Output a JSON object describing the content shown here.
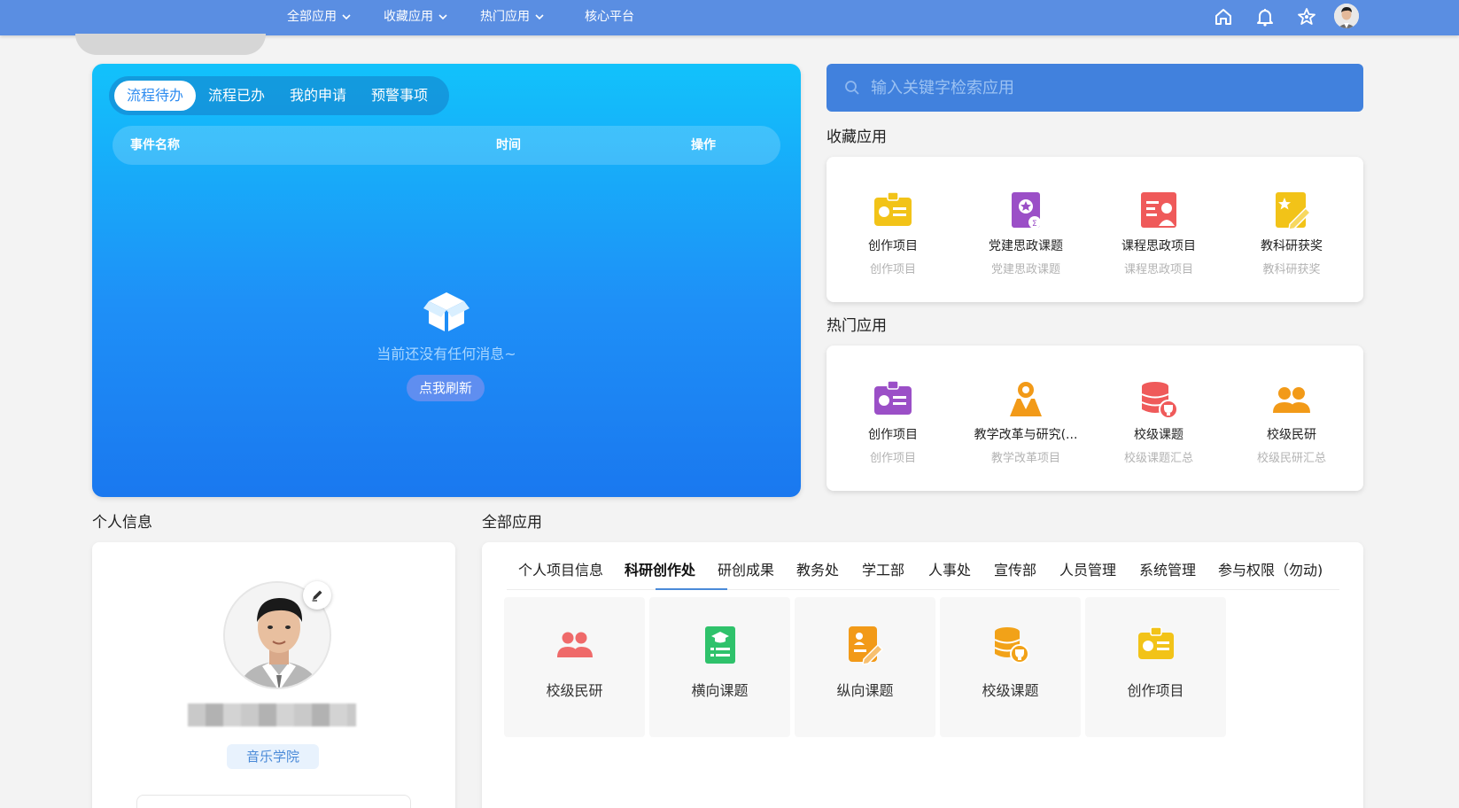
{
  "nav": {
    "items": [
      {
        "label": "全部应用",
        "dropdown": true
      },
      {
        "label": "收藏应用",
        "dropdown": true
      },
      {
        "label": "热门应用",
        "dropdown": true
      },
      {
        "label": "核心平台",
        "dropdown": false
      }
    ],
    "icons": [
      "home-icon",
      "bell-icon",
      "settings-star-icon"
    ]
  },
  "todo": {
    "tabs": [
      "流程待办",
      "流程已办",
      "我的申请",
      "预警事项"
    ],
    "active_tab": "流程待办",
    "columns": {
      "name": "事件名称",
      "time": "时间",
      "action": "操作"
    },
    "empty_text": "当前还没有任何消息~",
    "refresh_label": "点我刷新"
  },
  "search": {
    "placeholder": "输入关键字检索应用"
  },
  "favorites": {
    "title": "收藏应用",
    "apps": [
      {
        "name": "创作项目",
        "sub": "创作项目",
        "icon": "creative-project-icon",
        "color": "#f2c318"
      },
      {
        "name": "党建思政课题",
        "sub": "党建思政课题",
        "icon": "party-topic-icon",
        "color": "#9b4fc7"
      },
      {
        "name": "课程思政项目",
        "sub": "课程思政项目",
        "icon": "course-project-icon",
        "color": "#ef5a5a"
      },
      {
        "name": "教科研获奖",
        "sub": "教科研获奖",
        "icon": "award-icon",
        "color": "#f2c318"
      }
    ]
  },
  "hot": {
    "title": "热门应用",
    "apps": [
      {
        "name": "创作项目",
        "sub": "创作项目",
        "icon": "creative-project-icon",
        "color": "#9b4fc7"
      },
      {
        "name": "教学改革与研究(...",
        "sub": "教学改革项目",
        "icon": "teaching-reform-icon",
        "color": "#f29a18"
      },
      {
        "name": "校级课题",
        "sub": "校级课题汇总",
        "icon": "school-topic-icon",
        "color": "#ef5a5a"
      },
      {
        "name": "校级民研",
        "sub": "校级民研汇总",
        "icon": "people-research-icon",
        "color": "#f29a18"
      }
    ]
  },
  "profile": {
    "title": "个人信息",
    "department": "音乐学院"
  },
  "all_apps": {
    "title": "全部应用",
    "tabs": [
      "个人项目信息",
      "科研创作处",
      "研创成果",
      "教务处",
      "学工部",
      "人事处",
      "宣传部",
      "人员管理",
      "系统管理",
      "参与权限（勿动)"
    ],
    "active_tab": "科研创作处",
    "tiles": [
      {
        "name": "校级民研",
        "icon": "people-research-icon",
        "color": "#ef6a6a"
      },
      {
        "name": "横向课题",
        "icon": "horizontal-topic-icon",
        "color": "#2fc26b"
      },
      {
        "name": "纵向课题",
        "icon": "vertical-topic-icon",
        "color": "#f29a18"
      },
      {
        "name": "校级课题",
        "icon": "school-topic-icon",
        "color": "#f2a218"
      },
      {
        "name": "创作项目",
        "icon": "creative-project-icon",
        "color": "#f2c318"
      }
    ]
  }
}
